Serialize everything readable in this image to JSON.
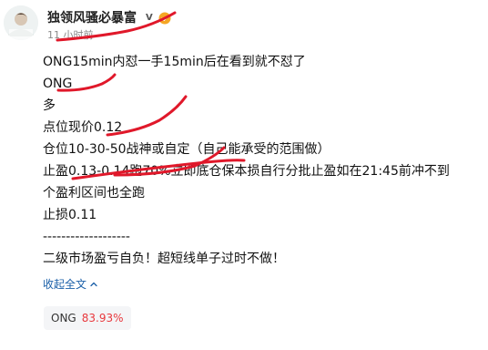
{
  "author": {
    "name": "独领风骚必暴富",
    "level": "V"
  },
  "timestamp": "11 小时前",
  "post": {
    "lines": [
      "ONG15min内怼一手15min后在看到就不怼了",
      "ONG",
      "多",
      "点位现价0.12",
      "仓位10-30-50战神或自定（自己能承受的范围做）",
      "止盈0.13-0.14跑70%立即底仓保本损自行分批止盈如在21:45前冲不到",
      "个盈利区间也全跑",
      "止损0.11",
      "-------------------",
      "二级市场盈亏自负！超短线单子过时不做！"
    ]
  },
  "collapse_label": "收起全文",
  "ticker": {
    "symbol": "ONG",
    "change": "83.93%"
  },
  "colors": {
    "link": "#1a5fa8",
    "negative": "#e8383d",
    "annotation": "#e0182a",
    "verified": "#f5a623"
  },
  "icons": {
    "avatar": "user-avatar",
    "verified": "verified-badge-icon",
    "collapse": "chevron-up-icon"
  }
}
